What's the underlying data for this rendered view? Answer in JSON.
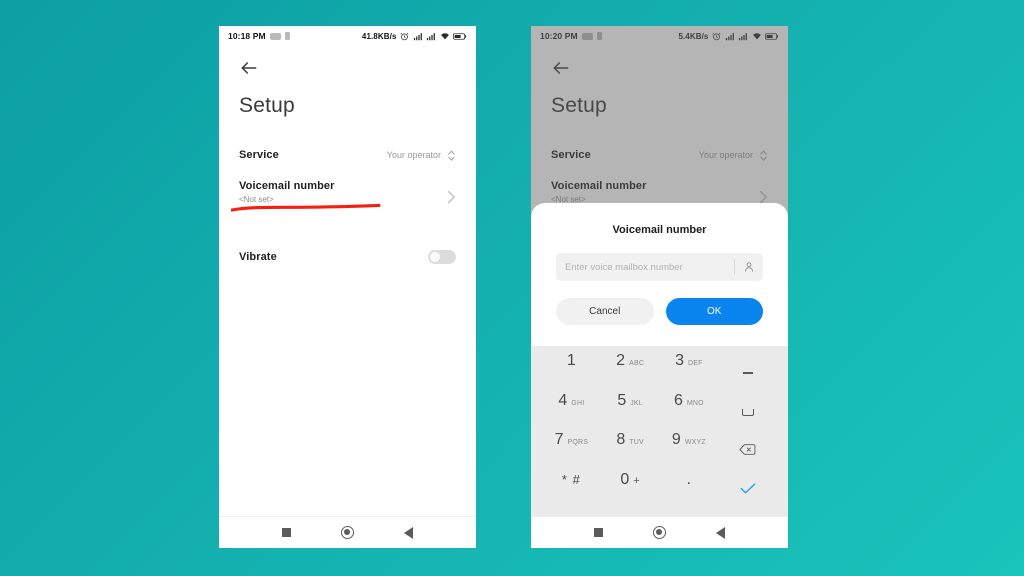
{
  "background": {
    "gradient_from": "#0c9fa4",
    "gradient_to": "#19c4bb"
  },
  "phones": [
    {
      "id": "left",
      "status_bar": {
        "clock": "10:18 PM",
        "network_speed": "41.8KB/s",
        "icons": [
          "alarm-icon",
          "signal-icon",
          "signal-2-icon",
          "wifi-icon",
          "battery-icon"
        ]
      },
      "app": {
        "back_label": "Back",
        "title": "Setup",
        "rows": [
          {
            "title": "Service",
            "value": "Your operator",
            "control": "stepper"
          },
          {
            "title": "Voicemail number",
            "subtitle": "<Not set>",
            "control": "chevron"
          },
          {
            "title": "Vibrate",
            "control": "toggle",
            "toggle_on": false
          }
        ]
      },
      "annotation": {
        "type": "red-underline",
        "color": "#f91d10",
        "target": "Voicemail number"
      },
      "nav_bar": {
        "recents": "recents-button",
        "home": "home-button",
        "back": "back-button"
      }
    },
    {
      "id": "right",
      "dimmed": true,
      "status_bar": {
        "clock": "10:20 PM",
        "network_speed": "5.4KB/s",
        "icons": [
          "alarm-icon",
          "signal-icon",
          "signal-2-icon",
          "wifi-icon",
          "battery-icon"
        ]
      },
      "app": {
        "back_label": "Back",
        "title": "Setup",
        "rows": [
          {
            "title": "Service",
            "value": "Your operator",
            "control": "stepper"
          },
          {
            "title": "Voicemail number",
            "subtitle": "<Not set>",
            "control": "chevron"
          }
        ]
      },
      "dialog": {
        "title": "Voicemail number",
        "input": {
          "value": "",
          "placeholder": "Enter voice mailbox number"
        },
        "contact_button": "contacts-picker",
        "buttons": {
          "cancel": "Cancel",
          "ok": "OK",
          "ok_color": "#0a84ef"
        },
        "keypad": [
          {
            "num": "1",
            "sub": ""
          },
          {
            "num": "2",
            "sub": "ABC"
          },
          {
            "num": "3",
            "sub": "DEF"
          },
          {
            "icon": "dash-key"
          },
          {
            "num": "4",
            "sub": "GHI"
          },
          {
            "num": "5",
            "sub": "JKL"
          },
          {
            "num": "6",
            "sub": "MNO"
          },
          {
            "icon": "space-key"
          },
          {
            "num": "7",
            "sub": "PQRS"
          },
          {
            "num": "8",
            "sub": "TUV"
          },
          {
            "num": "9",
            "sub": "WXYZ"
          },
          {
            "icon": "backspace-key"
          },
          {
            "num": "* #",
            "sub": "",
            "symbol": true
          },
          {
            "num": "0",
            "sub": "+"
          },
          {
            "num": ".",
            "sub": "",
            "dot": true
          },
          {
            "icon": "confirm-check-key"
          }
        ]
      },
      "nav_bar": {
        "recents": "recents-button",
        "home": "home-button",
        "back": "back-button"
      }
    }
  ]
}
